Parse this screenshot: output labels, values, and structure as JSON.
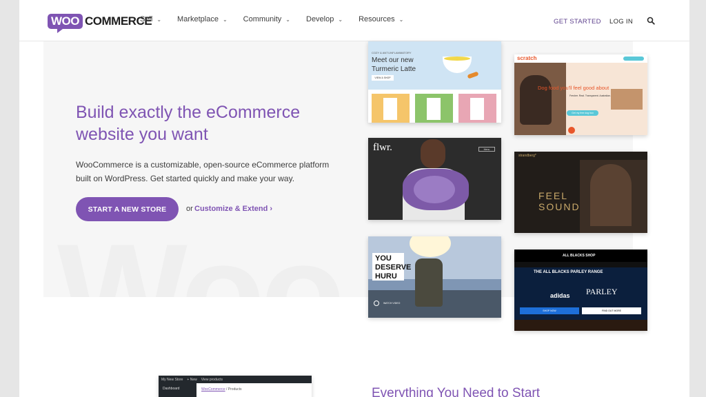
{
  "header": {
    "logo_woo": "WOO",
    "logo_commerce": "COMMERCE",
    "nav": [
      {
        "label": "Sell"
      },
      {
        "label": "Marketplace"
      },
      {
        "label": "Community"
      },
      {
        "label": "Develop"
      },
      {
        "label": "Resources"
      }
    ],
    "get_started": "GET STARTED",
    "login": "LOG IN",
    "search_icon": "search-icon"
  },
  "hero": {
    "title": "Build exactly the eCommerce website you want",
    "description": "WooCommerce is a customizable, open-source eCommerce platform built on WordPress. Get started quickly and make your way.",
    "cta_label": "START A NEW STORE",
    "or_text": "or",
    "customize_label": "Customize & Extend ›",
    "watermark": "Woo"
  },
  "showcase": {
    "turmeric": {
      "eyebrow": "COZY & ANTI-INFLAMMATORY",
      "headline": "Meet our new Turmeric Latte",
      "cta": "VIEW & SHOP"
    },
    "scratch": {
      "logo": "scratch",
      "headline": "Dog food you'll feel good about",
      "sub": "Fresher. Real. Transparent. Australian.",
      "cta": "Get my free dog box"
    },
    "flwr": {
      "logo": "flwr.",
      "menu": "Menu"
    },
    "strandberg": {
      "logo": "strandberg*",
      "headline_1": "FEEL",
      "headline_2": "SOUND"
    },
    "huru": {
      "headline_1": "YOU",
      "headline_2": "DESERVE",
      "headline_3": "HURU",
      "play": "WATCH VIDEO"
    },
    "allblacks": {
      "shop": "ALL BLACKS SHOP",
      "range": "THE ALL BLACKS PARLEY RANGE",
      "brand_left": "adidas",
      "brand_right": "PARLEY",
      "shop_now": "SHOP NOW",
      "find_out": "FIND OUT MORE"
    }
  },
  "admin": {
    "site": "My New Store",
    "new": "+ New",
    "view": "View products",
    "dashboard": "Dashboard",
    "crumb_link": "WooCommerce",
    "crumb_rest": " / Products"
  },
  "section2": {
    "title": "Everything You Need to Start"
  },
  "colors": {
    "brand": "#7f54b3",
    "nav_text": "#3c3c3c"
  }
}
